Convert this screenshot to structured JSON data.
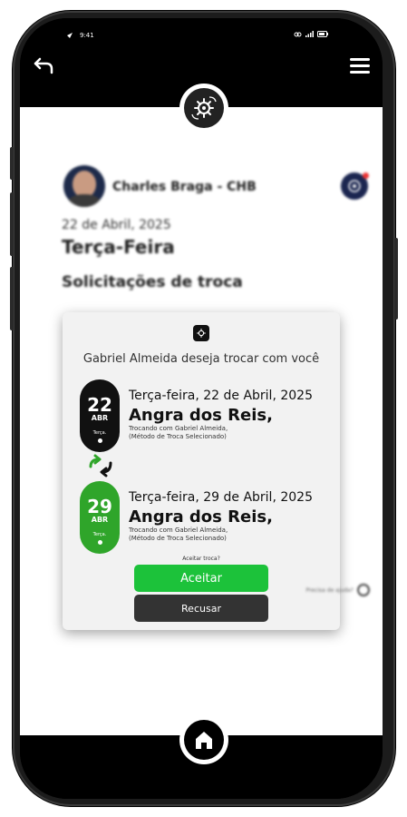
{
  "status_bar": {
    "time": "9:41"
  },
  "user": {
    "name": "Charles Braga - CHB"
  },
  "date_header": {
    "date": "22 de Abril, 2025",
    "weekday": "Terça-Feira"
  },
  "section": {
    "title": "Solicitações de troca"
  },
  "modal": {
    "heading": "Gabriel Almeida deseja trocar com você",
    "trips": [
      {
        "day": "22",
        "month": "ABR",
        "weekday_short": "Terça.",
        "date": "Terça-feira, 22 de Abril, 2025",
        "destination": "Angra dos Reis,",
        "note_line1": "Trocando com Gabriel Almeida,",
        "note_line2": "(Método de Troca Selecionado)",
        "color": "#111111"
      },
      {
        "day": "29",
        "month": "ABR",
        "weekday_short": "Terça.",
        "date": "Terça-feira, 29 de Abril, 2025",
        "destination": "Angra dos Reis,",
        "note_line1": "Trocando com Gabriel Almeida,",
        "note_line2": "(Método de Troca Selecionado)",
        "color": "#2fa52a"
      }
    ],
    "question": "Aceitar troca?",
    "accept_label": "Aceitar",
    "refuse_label": "Recusar"
  },
  "help": {
    "label": "Precisa de ajuda?"
  },
  "colors": {
    "accent_green": "#1cc23a",
    "dark_button": "#333333",
    "badge_navy": "#1b2650"
  },
  "icons": [
    "back-arrow-icon",
    "menu-icon",
    "ship-wheel-swap-icon",
    "notification-badge-icon",
    "swap-arrows-icon",
    "help-headset-icon",
    "home-icon"
  ]
}
